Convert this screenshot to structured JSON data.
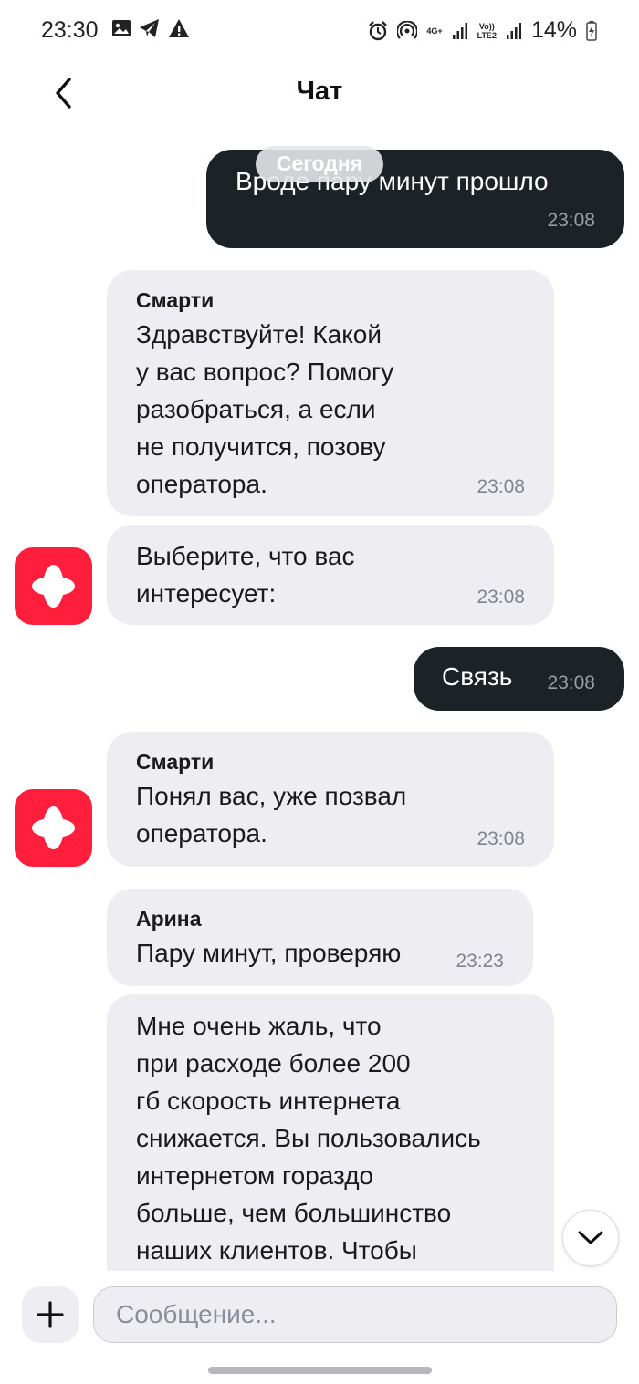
{
  "status_bar": {
    "time": "23:30",
    "network_top": "4G+",
    "volte_label": "Vo))",
    "lte_label": "LTE2",
    "battery": "14%"
  },
  "header": {
    "title": "Чат"
  },
  "date_separator": "Сегодня",
  "messages": [
    {
      "direction": "out",
      "text": "Вроде пару минут прошло",
      "time": "23:08"
    },
    {
      "direction": "in",
      "sender": "Смарти",
      "text": "Здравствуйте! Какой\nу вас вопрос? Помогу\nразобраться, а если\nне получится, позову\nоператора.",
      "time": "23:08"
    },
    {
      "direction": "in",
      "text": "Выберите, что вас\nинтересует:",
      "time": "23:08"
    },
    {
      "direction": "out",
      "text": "Связь",
      "time": "23:08"
    },
    {
      "direction": "in",
      "sender": "Смарти",
      "text": "Понял вас, уже позвал\nоператора.",
      "time": "23:08"
    },
    {
      "direction": "in",
      "sender": "Арина",
      "text": "Пару минут, проверяю",
      "time": "23:23"
    },
    {
      "direction": "in",
      "text": "Мне очень жаль, что\nпри расходе более 200\nгб скорость интернета\nснижается. Вы пользовались\nинтернетом гораздо\nбольше, чем большинство\nнаших клиентов. Чтобы"
    }
  ],
  "composer": {
    "placeholder": "Сообщение..."
  },
  "colors": {
    "incoming_bubble": "#eeeef2",
    "outgoing_bubble": "#1d2226",
    "avatar": "#ff1e3c"
  },
  "icons": {
    "back": "chevron-left-icon",
    "scroll": "chevron-down-icon",
    "attach": "plus-icon",
    "avatar": "bot-logo-icon"
  }
}
